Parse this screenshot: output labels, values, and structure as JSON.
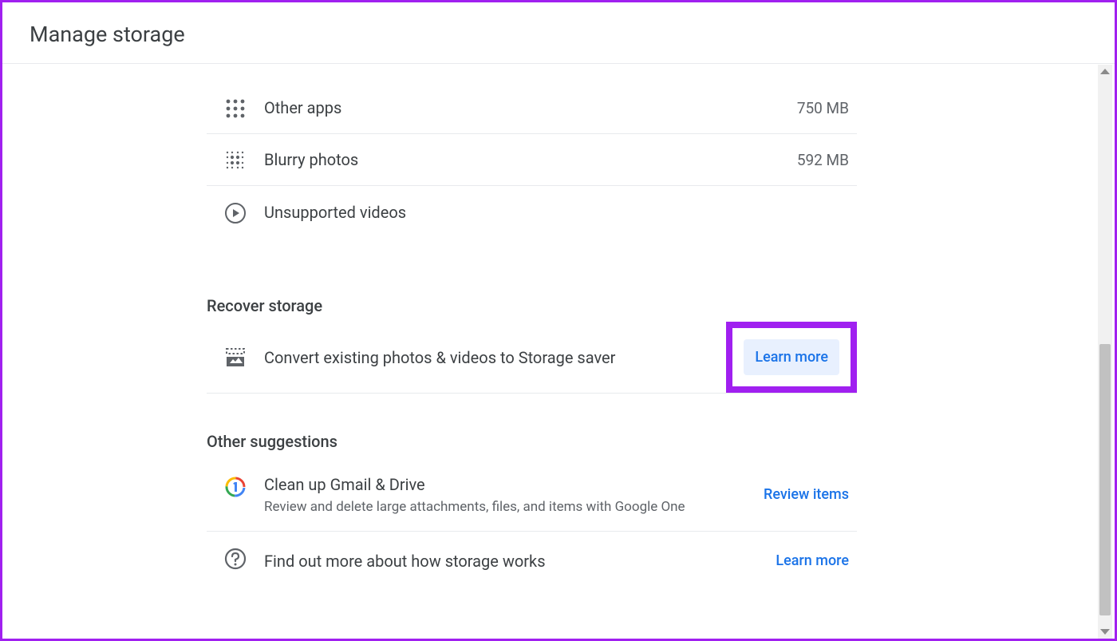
{
  "page": {
    "title": "Manage storage"
  },
  "storage_items": [
    {
      "label": "Other apps",
      "value": "750 MB"
    },
    {
      "label": "Blurry photos",
      "value": "592 MB"
    },
    {
      "label": "Unsupported videos",
      "value": ""
    }
  ],
  "recover": {
    "title": "Recover storage",
    "item_label": "Convert existing photos & videos to Storage saver",
    "action": "Learn more"
  },
  "suggestions": {
    "title": "Other suggestions",
    "items": [
      {
        "label": "Clean up Gmail & Drive",
        "sub": "Review and delete large attachments, files, and items with Google One",
        "action": "Review items"
      },
      {
        "label": "Find out more about how storage works",
        "sub": "",
        "action": "Learn more"
      }
    ]
  }
}
